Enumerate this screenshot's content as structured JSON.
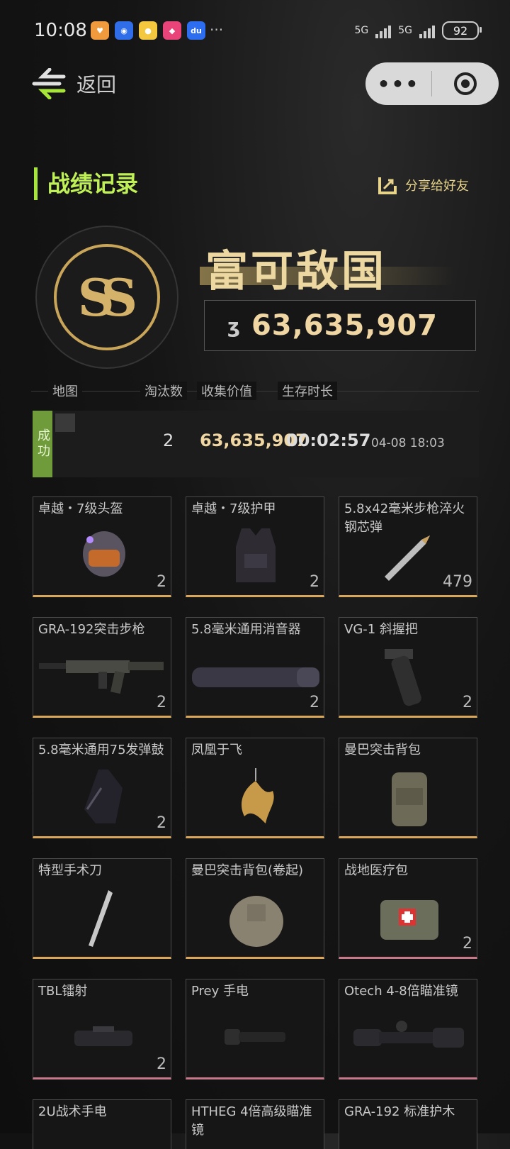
{
  "status_bar": {
    "time": "10:08",
    "apps": [
      {
        "icon": "heart-app-icon",
        "color": "#f09a3e"
      },
      {
        "icon": "browser-app-icon",
        "color": "#2f6ee8"
      },
      {
        "icon": "chrome-app-icon",
        "color": "#f3c73e"
      },
      {
        "icon": "shop-app-icon",
        "color": "#e8447a"
      },
      {
        "icon": "baidu-app-icon",
        "color": "#2d6ef0"
      }
    ],
    "signal_1": "5G",
    "signal_2": "5G",
    "battery": "92"
  },
  "nav": {
    "back_label": "返回",
    "more_label": "•••"
  },
  "header": {
    "title": "战绩记录",
    "share_label": "分享给好友"
  },
  "rank": {
    "badge_text": "SS",
    "title": "富可敌国",
    "value": "63,635,907"
  },
  "table": {
    "headers": [
      "地图",
      "淘汰数",
      "收集价值",
      "生存时长"
    ],
    "row": {
      "status": "成功",
      "kills": "2",
      "value": "63,635,907",
      "duration": "00:02:57",
      "date": "04-08 18:03"
    }
  },
  "items": [
    {
      "name": "卓越・7级头盔",
      "qty": "2",
      "icon": "helmet-icon",
      "accent": "gold"
    },
    {
      "name": "卓越・7级护甲",
      "qty": "2",
      "icon": "armor-vest-icon",
      "accent": "gold"
    },
    {
      "name": "5.8x42毫米步枪淬火钢芯弹",
      "qty": "479",
      "icon": "bullet-icon",
      "accent": "gold"
    },
    {
      "name": "GRA-192突击步枪",
      "qty": "2",
      "icon": "assault-rifle-icon",
      "accent": "gold"
    },
    {
      "name": "5.8毫米通用消音器",
      "qty": "2",
      "icon": "suppressor-icon",
      "accent": "gold"
    },
    {
      "name": "VG-1 斜握把",
      "qty": "2",
      "icon": "grip-icon",
      "accent": "gold"
    },
    {
      "name": "5.8毫米通用75发弹鼓",
      "qty": "2",
      "icon": "magazine-icon",
      "accent": "gold"
    },
    {
      "name": "凤凰于飞",
      "qty": "",
      "icon": "phoenix-icon",
      "accent": "gold"
    },
    {
      "name": "曼巴突击背包",
      "qty": "",
      "icon": "backpack-icon",
      "accent": "gold"
    },
    {
      "name": "特型手术刀",
      "qty": "",
      "icon": "scalpel-icon",
      "accent": "gold"
    },
    {
      "name": "曼巴突击背包(卷起)",
      "qty": "",
      "icon": "rolled-backpack-icon",
      "accent": "gold"
    },
    {
      "name": "战地医疗包",
      "qty": "2",
      "icon": "medkit-icon",
      "accent": "pink"
    },
    {
      "name": "TBL镭射",
      "qty": "2",
      "icon": "laser-icon",
      "accent": "pink"
    },
    {
      "name": "Prey 手电",
      "qty": "",
      "icon": "flashlight-icon",
      "accent": "pink"
    },
    {
      "name": "Otech 4-8倍瞄准镜",
      "qty": "",
      "icon": "scope-icon",
      "accent": "pink"
    },
    {
      "name": "2U战术手电",
      "qty": "",
      "icon": "tactical-flashlight-icon",
      "accent": "none"
    },
    {
      "name": "HTHEG 4倍高级瞄准镜",
      "qty": "",
      "icon": "advanced-scope-icon",
      "accent": "none"
    },
    {
      "name": "GRA-192 标准护木",
      "qty": "",
      "icon": "handguard-icon",
      "accent": "none"
    }
  ]
}
